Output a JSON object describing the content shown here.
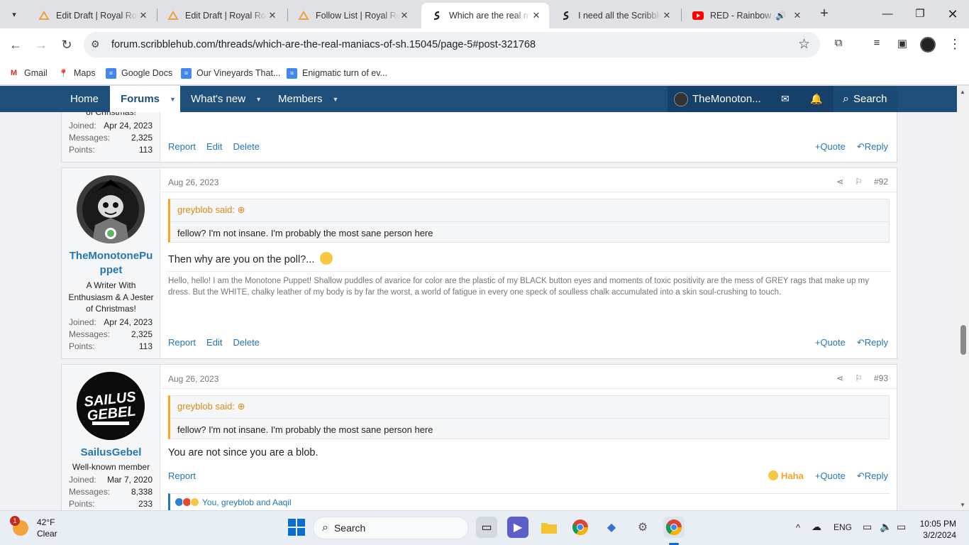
{
  "browser": {
    "tabs": [
      {
        "title": "Edit Draft | Royal Road",
        "icon": "royalroad-icon"
      },
      {
        "title": "Edit Draft | Royal Road",
        "icon": "royalroad-icon"
      },
      {
        "title": "Follow List | Royal Road",
        "icon": "royalroad-icon"
      },
      {
        "title": "Which are the real maniacs",
        "icon": "scribblehub-icon",
        "active": true
      },
      {
        "title": "I need all the Scribble",
        "icon": "scribblehub-icon"
      },
      {
        "title": "RED - Rainbow Fr",
        "icon": "youtube-icon"
      }
    ],
    "url": "forum.scribblehub.com/threads/which-are-the-real-maniacs-of-sh.15045/page-5#post-321768",
    "bookmarks": [
      {
        "label": "Gmail",
        "icon": "gmail-icon"
      },
      {
        "label": "Maps",
        "icon": "maps-icon"
      },
      {
        "label": "Google Docs",
        "icon": "docs-icon"
      },
      {
        "label": "Our Vineyards That...",
        "icon": "docs-icon"
      },
      {
        "label": "Enigmatic turn of ev...",
        "icon": "docs-icon"
      }
    ]
  },
  "forum_nav": {
    "home": "Home",
    "forums": "Forums",
    "whats_new": "What's new",
    "members": "Members",
    "user": "TheMonoton...",
    "search": "Search"
  },
  "post_top": {
    "utitle_tail": "of Christmas!",
    "joined_label": "Joined:",
    "joined": "Apr 24, 2023",
    "messages_label": "Messages:",
    "messages": "2,325",
    "points_label": "Points:",
    "points": "113",
    "actions": [
      "Report",
      "Edit",
      "Delete"
    ],
    "quote": "Quote",
    "reply": "Reply"
  },
  "post_92": {
    "date": "Aug 26, 2023",
    "number": "#92",
    "username_line1": "TheMonotonePu",
    "username_line2": "ppet",
    "user_title": "A Writer With Enthusiasm & A Jester of Christmas!",
    "joined_label": "Joined:",
    "joined": "Apr 24, 2023",
    "messages_label": "Messages:",
    "messages": "2,325",
    "points_label": "Points:",
    "points": "113",
    "quote_author": "greyblob said:",
    "quote_text": "fellow? I'm not insane. I'm probably the most sane person here",
    "body": "Then why are you on the poll?...",
    "signature": "Hello, hello! I am the Monotone Puppet! Shallow puddles of avarice for color are the plastic of my BLACK button eyes and moments of toxic positivity are the mess of GREY rags that make up my dress. But the WHITE, chalky leather of my body is by far the worst, a world of fatigue in every one speck of soulless chalk accumulated into a skin soul-crushing to touch.",
    "actions": [
      "Report",
      "Edit",
      "Delete"
    ],
    "quote": "Quote",
    "reply": "Reply"
  },
  "post_93": {
    "date": "Aug 26, 2023",
    "number": "#93",
    "username": "SailusGebel",
    "user_title": "Well-known member",
    "avatar_text": "SAILUS GEBEL",
    "joined_label": "Joined:",
    "joined": "Mar 7, 2020",
    "messages_label": "Messages:",
    "messages": "8,338",
    "points_label": "Points:",
    "points": "233",
    "quote_author": "greyblob said:",
    "quote_text": "fellow? I'm not insane. I'm probably the most sane person here",
    "body": "You are not since you are a blob.",
    "actions": [
      "Report"
    ],
    "haha": "Haha",
    "quote": "Quote",
    "reply": "Reply",
    "reactions": "You, greyblob and Aaqil"
  },
  "taskbar": {
    "temp": "42°F",
    "weather": "Clear",
    "badge": "1",
    "search": "Search",
    "lang": "ENG",
    "time": "10:05 PM",
    "date": "3/2/2024"
  }
}
